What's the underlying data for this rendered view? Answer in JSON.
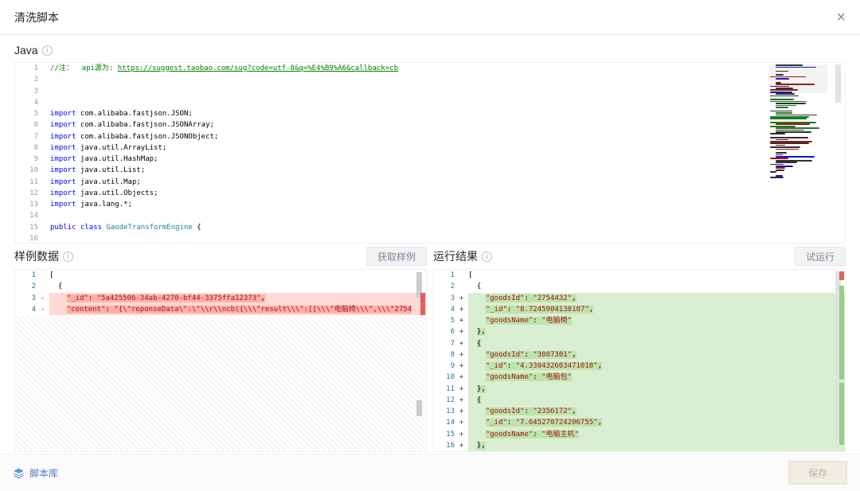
{
  "modal": {
    "title": "清洗脚本",
    "close_icon": "×"
  },
  "language": {
    "label": "Java"
  },
  "icons": {
    "info": "i"
  },
  "colors": {
    "removed_line_bg": "#ffd9d6",
    "removed_char_bg": "#ffb0aa",
    "added_line_bg": "#daeed2",
    "added_char_bg": "#bee3ac",
    "accent_blue": "#4d7fb8"
  },
  "code_editor": {
    "lines": [
      {
        "n": "1",
        "segs": [
          {
            "t": "//注：  api源为: ",
            "c": "cm"
          },
          {
            "t": "https://suggest.taobao.com/sug?code=utf-8&q=%E4%B9%A6&callback=cb",
            "c": "cm link"
          }
        ]
      },
      {
        "n": "2",
        "segs": []
      },
      {
        "n": "3",
        "segs": []
      },
      {
        "n": "4",
        "segs": []
      },
      {
        "n": "5",
        "segs": [
          {
            "t": "import",
            "c": "kw"
          },
          {
            "t": " com.alibaba.fastjson.JSON;",
            "c": "pl"
          }
        ]
      },
      {
        "n": "6",
        "segs": [
          {
            "t": "import",
            "c": "kw"
          },
          {
            "t": " com.alibaba.fastjson.JSONArray;",
            "c": "pl"
          }
        ]
      },
      {
        "n": "7",
        "segs": [
          {
            "t": "import",
            "c": "kw"
          },
          {
            "t": " com.alibaba.fastjson.JSONObject;",
            "c": "pl"
          }
        ]
      },
      {
        "n": "8",
        "segs": [
          {
            "t": "import",
            "c": "kw"
          },
          {
            "t": " java.util.ArrayList;",
            "c": "pl"
          }
        ]
      },
      {
        "n": "9",
        "segs": [
          {
            "t": "import",
            "c": "kw"
          },
          {
            "t": " java.util.HashMap;",
            "c": "pl"
          }
        ]
      },
      {
        "n": "10",
        "segs": [
          {
            "t": "import",
            "c": "kw"
          },
          {
            "t": " java.util.List;",
            "c": "pl"
          }
        ]
      },
      {
        "n": "11",
        "segs": [
          {
            "t": "import",
            "c": "kw"
          },
          {
            "t": " java.util.Map;",
            "c": "pl"
          }
        ]
      },
      {
        "n": "12",
        "segs": [
          {
            "t": "import",
            "c": "kw"
          },
          {
            "t": " java.util.Objects;",
            "c": "pl"
          }
        ]
      },
      {
        "n": "13",
        "segs": [
          {
            "t": "import",
            "c": "kw"
          },
          {
            "t": " java.lang.*;",
            "c": "pl"
          }
        ]
      },
      {
        "n": "14",
        "segs": []
      },
      {
        "n": "15",
        "segs": [
          {
            "t": "public",
            "c": "kw"
          },
          {
            "t": " ",
            "c": "pl"
          },
          {
            "t": "class",
            "c": "kw"
          },
          {
            "t": " ",
            "c": "pl"
          },
          {
            "t": "GaodeTransformEngine",
            "c": "ty"
          },
          {
            "t": " {",
            "c": "pl"
          }
        ]
      },
      {
        "n": "16",
        "segs": []
      }
    ]
  },
  "sample_panel": {
    "title": "样例数据",
    "button_label": "获取样例",
    "lines": [
      {
        "n": "1",
        "sign": "",
        "type": "",
        "segs": [
          {
            "t": "[",
            "c": "pl"
          }
        ]
      },
      {
        "n": "2",
        "sign": "",
        "type": "",
        "segs": [
          {
            "t": "  {",
            "c": "pl"
          }
        ]
      },
      {
        "n": "3",
        "sign": "-",
        "type": "removed",
        "segs": [
          {
            "t": "    ",
            "c": ""
          },
          {
            "t": "\"_id\"",
            "c": "str hl"
          },
          {
            "t": ": ",
            "c": "pl hl"
          },
          {
            "t": "\"5a425506-34ab-4270-bf44-3375ffa12373\"",
            "c": "str hl"
          },
          {
            "t": ",",
            "c": "pl hl"
          }
        ]
      },
      {
        "n": "4",
        "sign": "-",
        "type": "removed",
        "segs": [
          {
            "t": "    ",
            "c": ""
          },
          {
            "t": "\"content\"",
            "c": "str hl"
          },
          {
            "t": ": ",
            "c": "pl hl"
          },
          {
            "t": "\"{\\\"reponseData\\\":\\\"\\\\r\\\\ncb({\\\\\\\"result\\\\\\\":[[\\\\\\\"电脑椅\\\\\\\",\\\\\\\"2754",
            "c": "str hl"
          }
        ]
      }
    ]
  },
  "result_panel": {
    "title": "运行结果",
    "button_label": "试运行",
    "lines": [
      {
        "n": "1",
        "sign": "",
        "type": "",
        "segs": [
          {
            "t": "[",
            "c": "pl"
          }
        ]
      },
      {
        "n": "2",
        "sign": "",
        "type": "",
        "segs": [
          {
            "t": "  {",
            "c": "pl"
          }
        ]
      },
      {
        "n": "3",
        "sign": "+",
        "type": "added",
        "segs": [
          {
            "t": "    ",
            "c": ""
          },
          {
            "t": "\"goodsId\"",
            "c": "str hl"
          },
          {
            "t": ": ",
            "c": "pl hl"
          },
          {
            "t": "\"2754432\"",
            "c": "str hl"
          },
          {
            "t": ",",
            "c": "pl hl"
          }
        ]
      },
      {
        "n": "4",
        "sign": "+",
        "type": "added",
        "segs": [
          {
            "t": "    ",
            "c": ""
          },
          {
            "t": "\"_id\"",
            "c": "str hl"
          },
          {
            "t": ": ",
            "c": "pl hl"
          },
          {
            "t": "\"8.7245904138187\"",
            "c": "str hl"
          },
          {
            "t": ",",
            "c": "pl hl"
          }
        ]
      },
      {
        "n": "5",
        "sign": "+",
        "type": "added",
        "segs": [
          {
            "t": "    ",
            "c": ""
          },
          {
            "t": "\"goodsName\"",
            "c": "str hl"
          },
          {
            "t": ": ",
            "c": "pl hl"
          },
          {
            "t": "\"电脑椅\"",
            "c": "str hl"
          }
        ]
      },
      {
        "n": "6",
        "sign": "+",
        "type": "added",
        "segs": [
          {
            "t": "  ",
            "c": ""
          },
          {
            "t": "},",
            "c": "pl hl"
          }
        ]
      },
      {
        "n": "7",
        "sign": "+",
        "type": "added",
        "segs": [
          {
            "t": "  ",
            "c": ""
          },
          {
            "t": "{",
            "c": "pl hl"
          }
        ]
      },
      {
        "n": "8",
        "sign": "+",
        "type": "added",
        "segs": [
          {
            "t": "    ",
            "c": ""
          },
          {
            "t": "\"goodsId\"",
            "c": "str hl"
          },
          {
            "t": ": ",
            "c": "pl hl"
          },
          {
            "t": "\"3087301\"",
            "c": "str hl"
          },
          {
            "t": ",",
            "c": "pl hl"
          }
        ]
      },
      {
        "n": "9",
        "sign": "+",
        "type": "added",
        "segs": [
          {
            "t": "    ",
            "c": ""
          },
          {
            "t": "\"_id\"",
            "c": "str hl"
          },
          {
            "t": ": ",
            "c": "pl hl"
          },
          {
            "t": "\"4.330432603471018\"",
            "c": "str hl"
          },
          {
            "t": ",",
            "c": "pl hl"
          }
        ]
      },
      {
        "n": "10",
        "sign": "+",
        "type": "added",
        "segs": [
          {
            "t": "    ",
            "c": ""
          },
          {
            "t": "\"goodsName\"",
            "c": "str hl"
          },
          {
            "t": ": ",
            "c": "pl hl"
          },
          {
            "t": "\"电脑包\"",
            "c": "str hl"
          }
        ]
      },
      {
        "n": "11",
        "sign": "+",
        "type": "added",
        "segs": [
          {
            "t": "  ",
            "c": ""
          },
          {
            "t": "},",
            "c": "pl hl"
          }
        ]
      },
      {
        "n": "12",
        "sign": "+",
        "type": "added",
        "segs": [
          {
            "t": "  ",
            "c": ""
          },
          {
            "t": "{",
            "c": "pl hl"
          }
        ]
      },
      {
        "n": "13",
        "sign": "+",
        "type": "added",
        "segs": [
          {
            "t": "    ",
            "c": ""
          },
          {
            "t": "\"goodsId\"",
            "c": "str hl"
          },
          {
            "t": ": ",
            "c": "pl hl"
          },
          {
            "t": "\"2356172\"",
            "c": "str hl"
          },
          {
            "t": ",",
            "c": "pl hl"
          }
        ]
      },
      {
        "n": "14",
        "sign": "+",
        "type": "added",
        "segs": [
          {
            "t": "    ",
            "c": ""
          },
          {
            "t": "\"_id\"",
            "c": "str hl"
          },
          {
            "t": ": ",
            "c": "pl hl"
          },
          {
            "t": "\"7.645270724206755\"",
            "c": "str hl"
          },
          {
            "t": ",",
            "c": "pl hl"
          }
        ]
      },
      {
        "n": "15",
        "sign": "+",
        "type": "added",
        "segs": [
          {
            "t": "    ",
            "c": ""
          },
          {
            "t": "\"goodsName\"",
            "c": "str hl"
          },
          {
            "t": ": ",
            "c": "pl hl"
          },
          {
            "t": "\"电脑主机\"",
            "c": "str hl"
          }
        ]
      },
      {
        "n": "16",
        "sign": "+",
        "type": "added",
        "segs": [
          {
            "t": "  ",
            "c": ""
          },
          {
            "t": "},",
            "c": "pl hl"
          }
        ]
      }
    ]
  },
  "footer": {
    "script_library_label": "脚本库",
    "save_label": "保存"
  }
}
